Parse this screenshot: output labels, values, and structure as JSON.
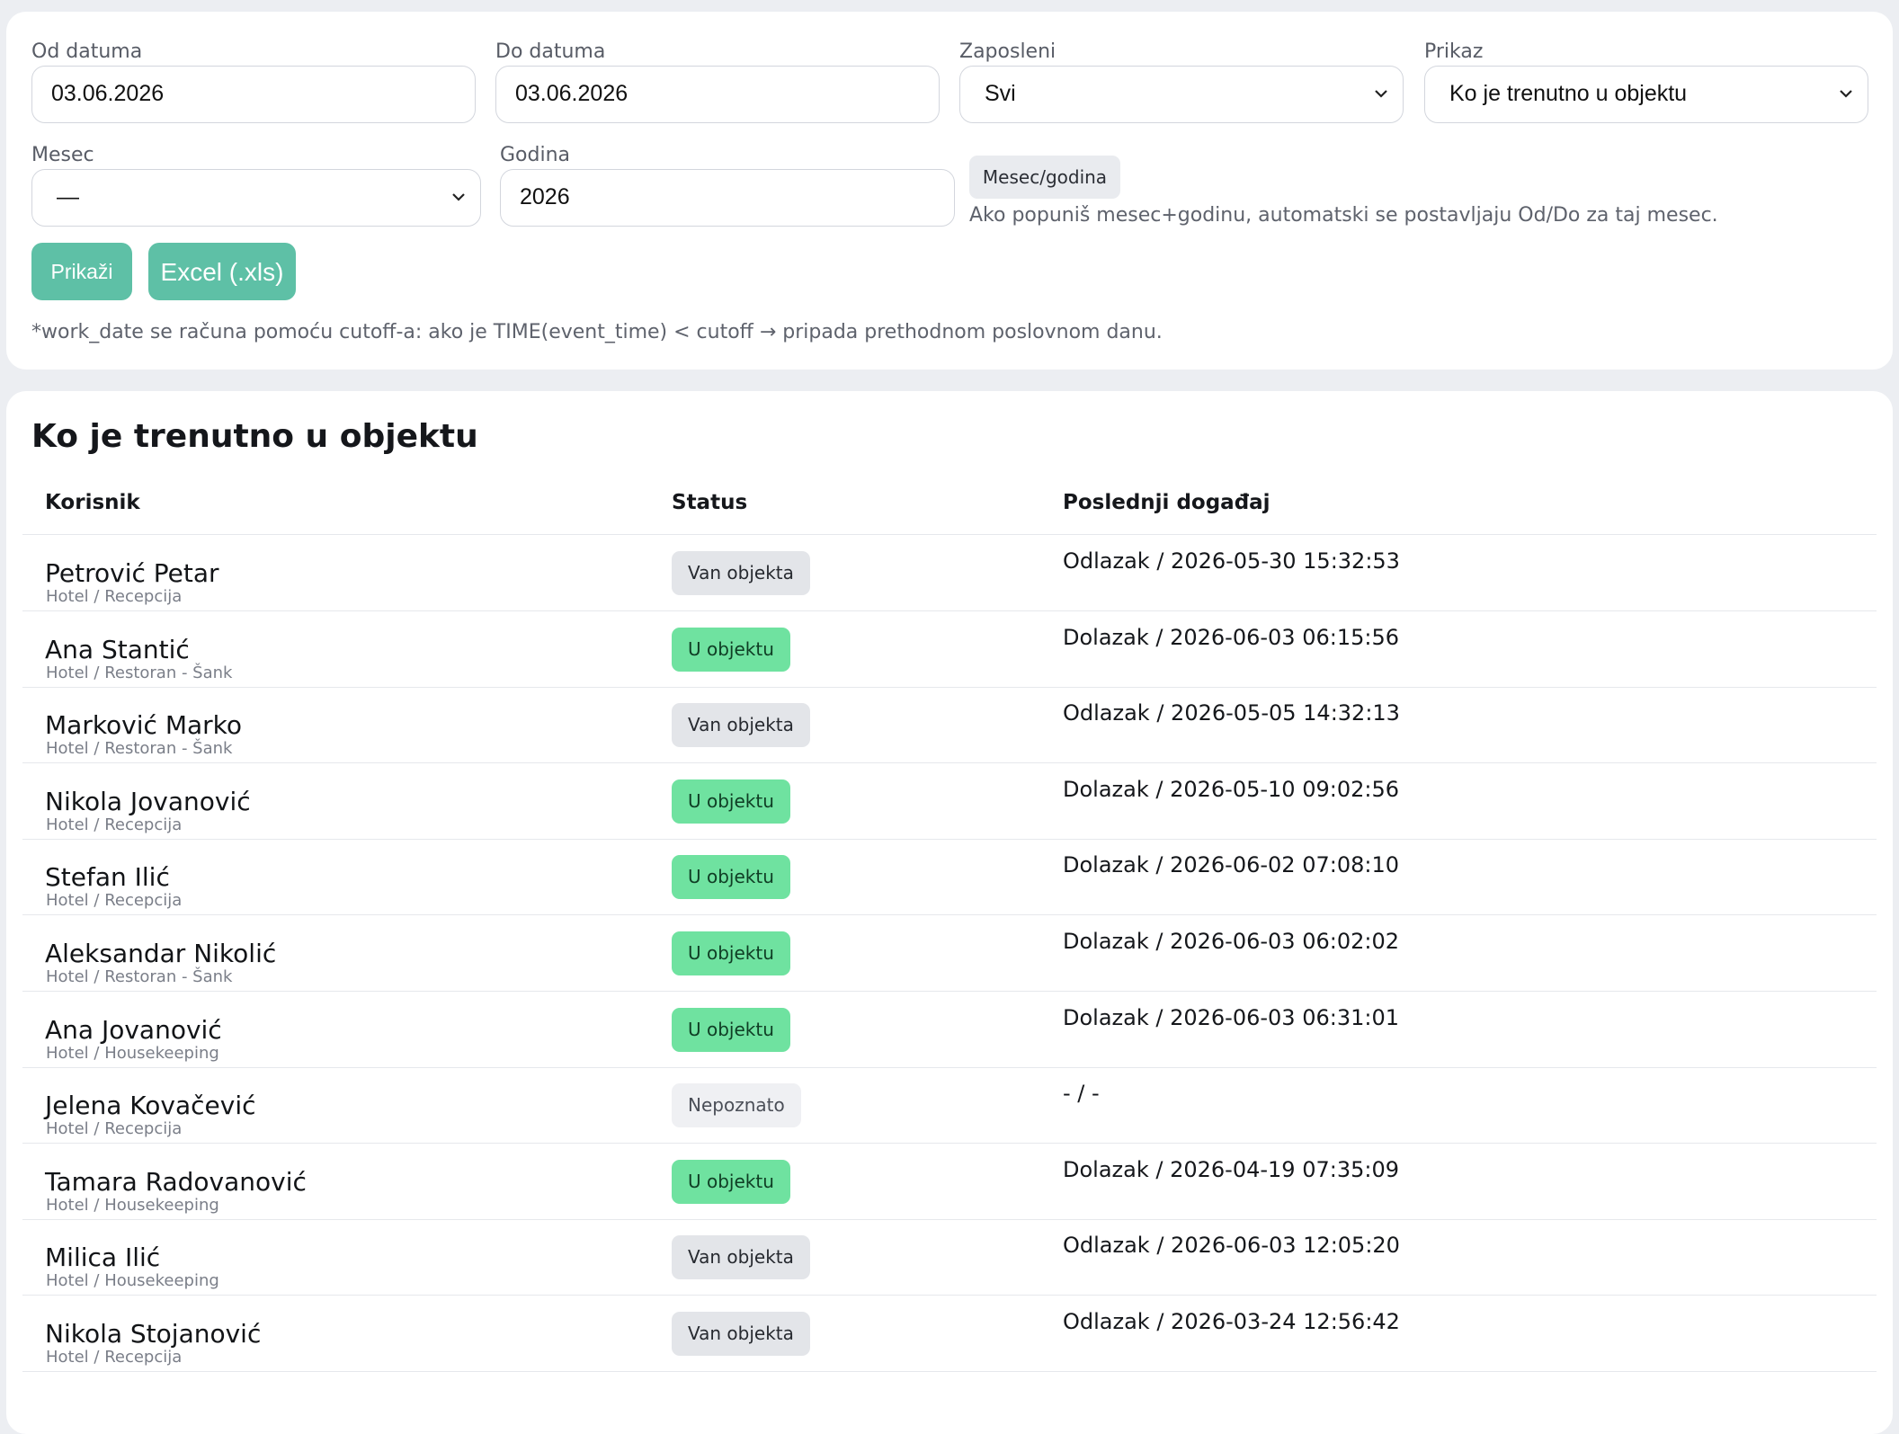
{
  "filters": {
    "from_label": "Od datuma",
    "from_value": "03.06.2026",
    "to_label": "Do datuma",
    "to_value": "03.06.2026",
    "employee_label": "Zaposleni",
    "employee_value": "Svi",
    "view_label": "Prikaz",
    "view_value": "Ko je trenutno u objektu",
    "month_label": "Mesec",
    "month_value": "—",
    "year_label": "Godina",
    "year_value": "2026",
    "month_year_chip": "Mesec/godina",
    "month_year_hint": "Ako popuniš mesec+godinu, automatski se postavljaju Od/Do za taj mesec.",
    "show_button": "Prikaži",
    "excel_button": "Excel (.xls)",
    "footnote": "*work_date se računa pomoću cutoff-a: ako je TIME(event_time) < cutoff → pripada prethodnom poslovnom danu."
  },
  "table": {
    "title": "Ko je trenutno u objektu",
    "headers": {
      "user": "Korisnik",
      "status": "Status",
      "last_event": "Poslednji događaj"
    },
    "rows": [
      {
        "name": "Petrović Petar",
        "dept": "Hotel / Recepcija",
        "status": "Van objekta",
        "status_kind": "out",
        "event": "Odlazak / 2026-05-30 15:32:53"
      },
      {
        "name": "Ana Stantić",
        "dept": "Hotel / Restoran - Šank",
        "status": "U objektu",
        "status_kind": "in",
        "event": "Dolazak / 2026-06-03 06:15:56"
      },
      {
        "name": "Marković Marko",
        "dept": "Hotel / Restoran - Šank",
        "status": "Van objekta",
        "status_kind": "out",
        "event": "Odlazak / 2026-05-05 14:32:13"
      },
      {
        "name": "Nikola Jovanović",
        "dept": "Hotel / Recepcija",
        "status": "U objektu",
        "status_kind": "in",
        "event": "Dolazak / 2026-05-10 09:02:56"
      },
      {
        "name": "Stefan Ilić",
        "dept": "Hotel / Recepcija",
        "status": "U objektu",
        "status_kind": "in",
        "event": "Dolazak / 2026-06-02 07:08:10"
      },
      {
        "name": "Aleksandar Nikolić",
        "dept": "Hotel / Restoran - Šank",
        "status": "U objektu",
        "status_kind": "in",
        "event": "Dolazak / 2026-06-03 06:02:02"
      },
      {
        "name": "Ana Jovanović",
        "dept": "Hotel / Housekeeping",
        "status": "U objektu",
        "status_kind": "in",
        "event": "Dolazak / 2026-06-03 06:31:01"
      },
      {
        "name": "Jelena Kovačević",
        "dept": "Hotel / Recepcija",
        "status": "Nepoznato",
        "status_kind": "unknown",
        "event": "- / -"
      },
      {
        "name": "Tamara Radovanović",
        "dept": "Hotel / Housekeeping",
        "status": "U objektu",
        "status_kind": "in",
        "event": "Dolazak / 2026-04-19 07:35:09"
      },
      {
        "name": "Milica Ilić",
        "dept": "Hotel / Housekeeping",
        "status": "Van objekta",
        "status_kind": "out",
        "event": "Odlazak / 2026-06-03 12:05:20"
      },
      {
        "name": "Nikola Stojanović",
        "dept": "Hotel / Recepcija",
        "status": "Van objekta",
        "status_kind": "out",
        "event": "Odlazak / 2026-03-24 12:56:42"
      }
    ]
  }
}
